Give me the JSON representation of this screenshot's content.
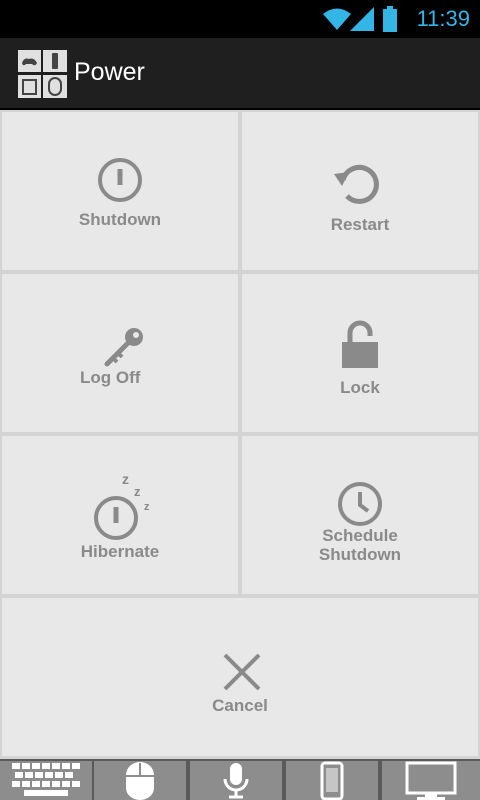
{
  "status_bar": {
    "time": "11:39"
  },
  "action_bar": {
    "title": "Power"
  },
  "tiles": [
    {
      "label": "Shutdown"
    },
    {
      "label": "Restart"
    },
    {
      "label": "Log Off"
    },
    {
      "label": "Lock"
    },
    {
      "label": "Hibernate"
    },
    {
      "label_line1": "Schedule",
      "label_line2": "Shutdown"
    },
    {
      "label": "Cancel"
    }
  ],
  "bottom_bar": [
    "keyboard-icon",
    "mouse-icon",
    "microphone-icon",
    "phone-icon",
    "monitor-icon"
  ]
}
